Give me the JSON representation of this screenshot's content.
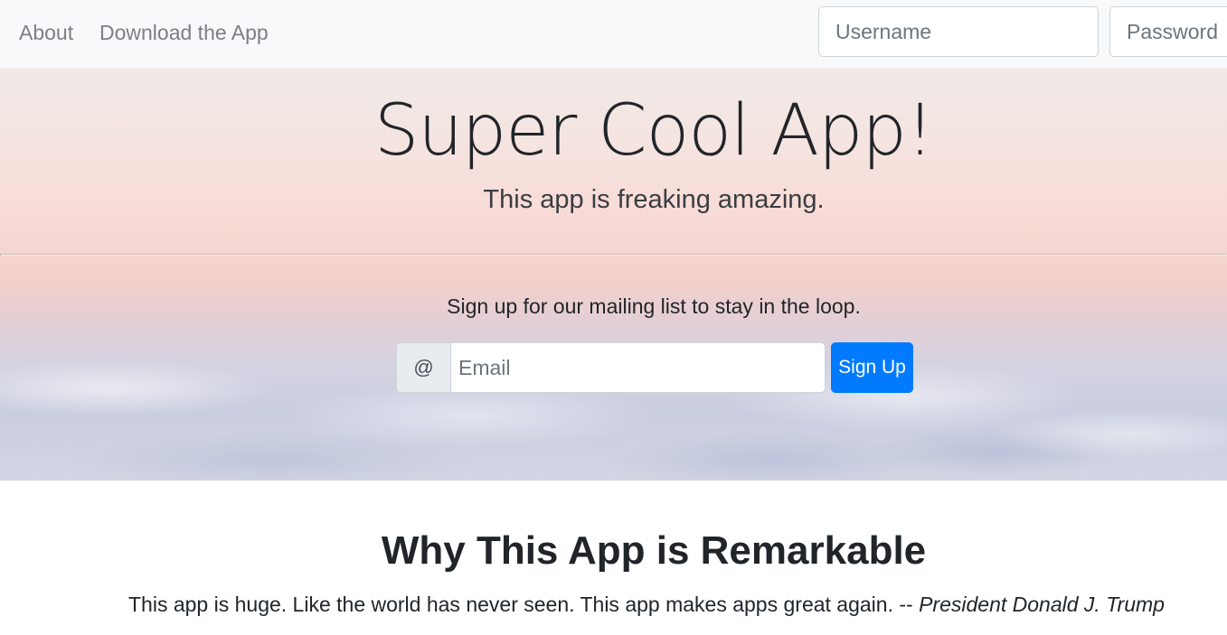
{
  "navbar": {
    "links": [
      {
        "label": "About"
      },
      {
        "label": "Download the App"
      }
    ],
    "username_placeholder": "Username",
    "password_placeholder": "Password"
  },
  "hero": {
    "title": "Super Cool App!",
    "subtitle": "This app is freaking amazing.",
    "tagline": "Sign up for our mailing list to stay in the loop.",
    "email_prepend": "@",
    "email_placeholder": "Email",
    "signup_label": "Sign Up"
  },
  "content": {
    "heading": "Why This App is Remarkable",
    "quote_text": "This app is huge. Like the world has never seen. This app makes apps great again. -- ",
    "quote_author": "President Donald J. Trump"
  },
  "colors": {
    "navbar_bg": "#f8f9fa",
    "primary": "#007bff"
  }
}
